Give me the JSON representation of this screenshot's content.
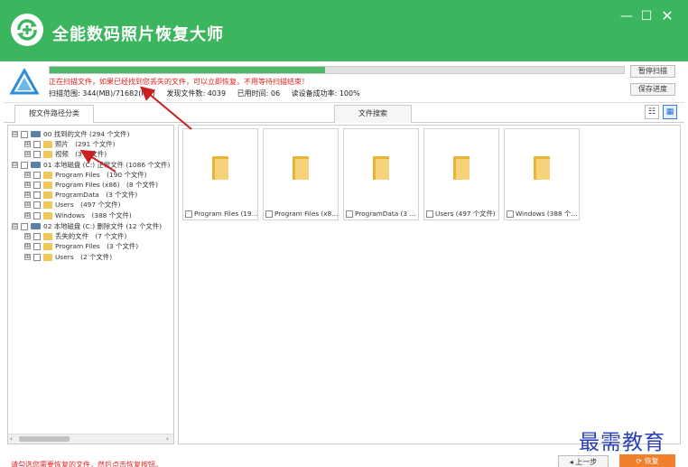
{
  "app": {
    "title": "全能数码照片恢复大师",
    "minimize": "—",
    "maximize": "☐",
    "close": "✕"
  },
  "scan": {
    "progress": 0.48,
    "message": "正在扫描文件，如果已经找到您丢失的文件，可以立即恢复，不用等待扫描结束！",
    "range": "扫描范围: 344(MB)/71682(MB)",
    "found": "发现文件数: 4039",
    "elapsed": "已用时间: 06",
    "success_rate": "读设备成功率: 100%",
    "pause_label": "暂停扫描",
    "save_label": "保存进度"
  },
  "tabs": {
    "by_path": "按文件路径分类",
    "search": "文件搜索",
    "list_view_icon": "☷",
    "grid_view_icon": "▦"
  },
  "tree": [
    {
      "label": "00 找到的文件 (294 个文件)",
      "type": "drive",
      "expander": "⊟"
    },
    {
      "label": "照片　(291 个文件)",
      "type": "folder",
      "expander": "⊞"
    },
    {
      "label": "视频　(3 个文件)",
      "type": "folder",
      "expander": "⊞"
    },
    {
      "label": "01 本地磁盘 (C:) 正常文件 (1086 个文件)",
      "type": "drive",
      "expander": "⊟"
    },
    {
      "label": "Program Files　(190 个文件)",
      "type": "folder",
      "expander": "⊞"
    },
    {
      "label": "Program Files (x86)　(8 个文件)",
      "type": "folder",
      "expander": "⊞"
    },
    {
      "label": "ProgramData　(3 个文件)",
      "type": "folder",
      "expander": "⊞"
    },
    {
      "label": "Users　(497 个文件)",
      "type": "folder",
      "expander": "⊞"
    },
    {
      "label": "Windows　(388 个文件)",
      "type": "folder",
      "expander": "⊞"
    },
    {
      "label": "02 本地磁盘 (C:) 删除文件 (12 个文件)",
      "type": "drive",
      "expander": "⊟"
    },
    {
      "label": "丢失的文件　(7 个文件)",
      "type": "folder",
      "expander": "⊞"
    },
    {
      "label": "Program Files　(3 个文件)",
      "type": "folder",
      "expander": "⊞"
    },
    {
      "label": "Users　(2 个文件)",
      "type": "folder",
      "expander": "⊞"
    }
  ],
  "files": [
    {
      "label": "Program Files (19…"
    },
    {
      "label": "Program Files (x8…"
    },
    {
      "label": "ProgramData (3 …"
    },
    {
      "label": "Users (497 个文件)"
    },
    {
      "label": "Windows (388 个…"
    }
  ],
  "bottom": {
    "message": "请勾选您需要恢复的文件，然后点击恢复按钮。",
    "prev_label": "◂ 上一步",
    "recover_label": "⟳ 恢复"
  },
  "watermark": "最需教育"
}
